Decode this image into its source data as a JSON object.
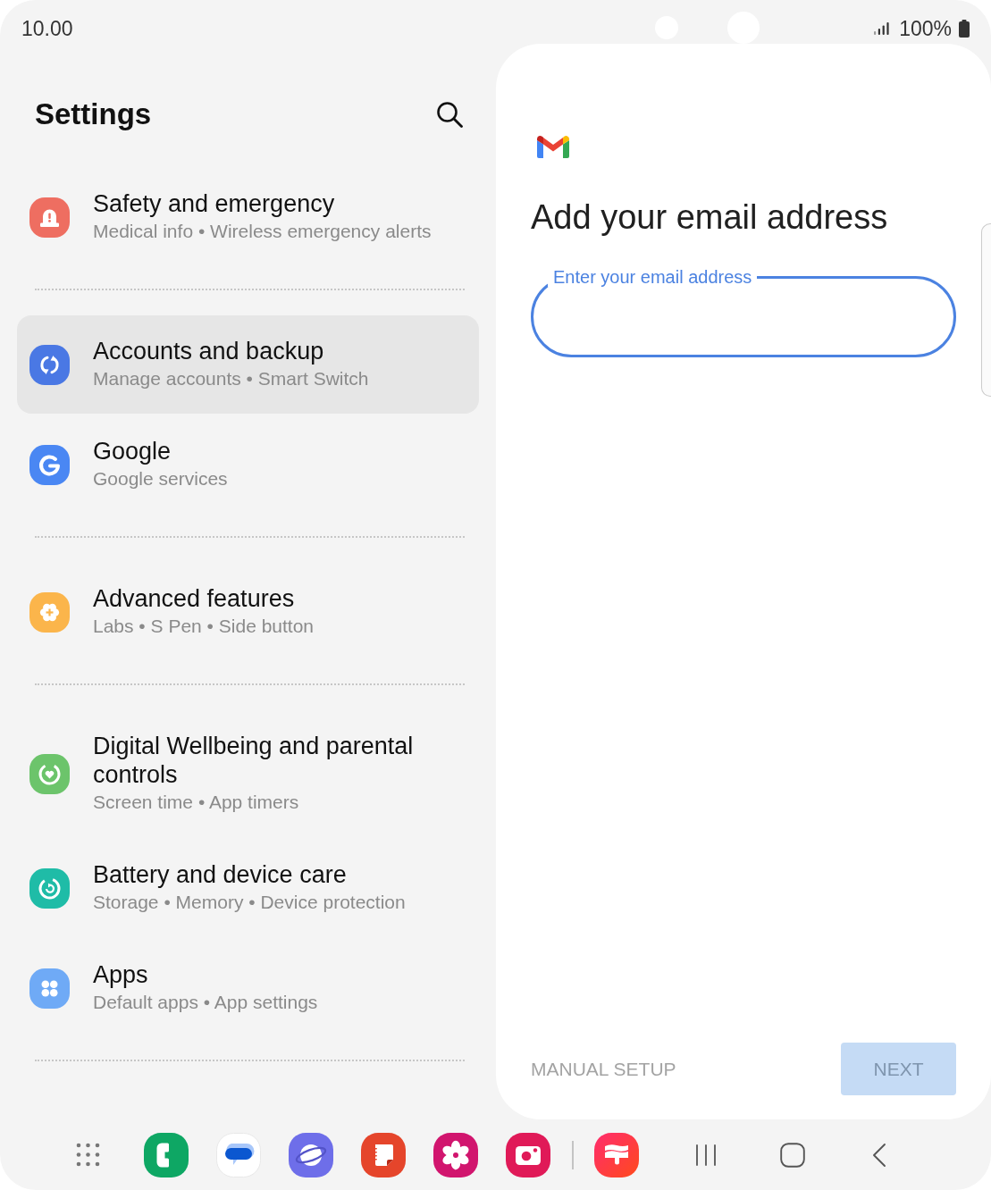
{
  "status_bar": {
    "time": "10.00",
    "battery": "100%"
  },
  "settings": {
    "title": "Settings",
    "groups": [
      {
        "items": [
          {
            "title": "Safety and emergency",
            "summary": "Medical info • Wireless emergency alerts",
            "selected": false
          }
        ]
      },
      {
        "items": [
          {
            "title": "Accounts and backup",
            "summary": "Manage accounts • Smart Switch",
            "selected": true
          },
          {
            "title": "Google",
            "summary": "Google services",
            "selected": false
          }
        ]
      },
      {
        "items": [
          {
            "title": "Advanced features",
            "summary": "Labs • S Pen • Side button",
            "selected": false
          }
        ]
      },
      {
        "items": [
          {
            "title": "Digital Wellbeing and parental controls",
            "summary": "Screen time • App timers",
            "selected": false
          },
          {
            "title": "Battery and device care",
            "summary": "Storage • Memory • Device protection",
            "selected": false
          },
          {
            "title": "Apps",
            "summary": "Default apps • App settings",
            "selected": false
          }
        ]
      }
    ]
  },
  "email_setup": {
    "heading": "Add your email address",
    "email_field": {
      "label": "Enter your email address",
      "focused": true
    },
    "buttons": [
      {
        "label": "MANUAL SETUP",
        "kind": "text",
        "disabled": true
      },
      {
        "label": "NEXT",
        "kind": "filled",
        "disabled": true
      }
    ]
  }
}
